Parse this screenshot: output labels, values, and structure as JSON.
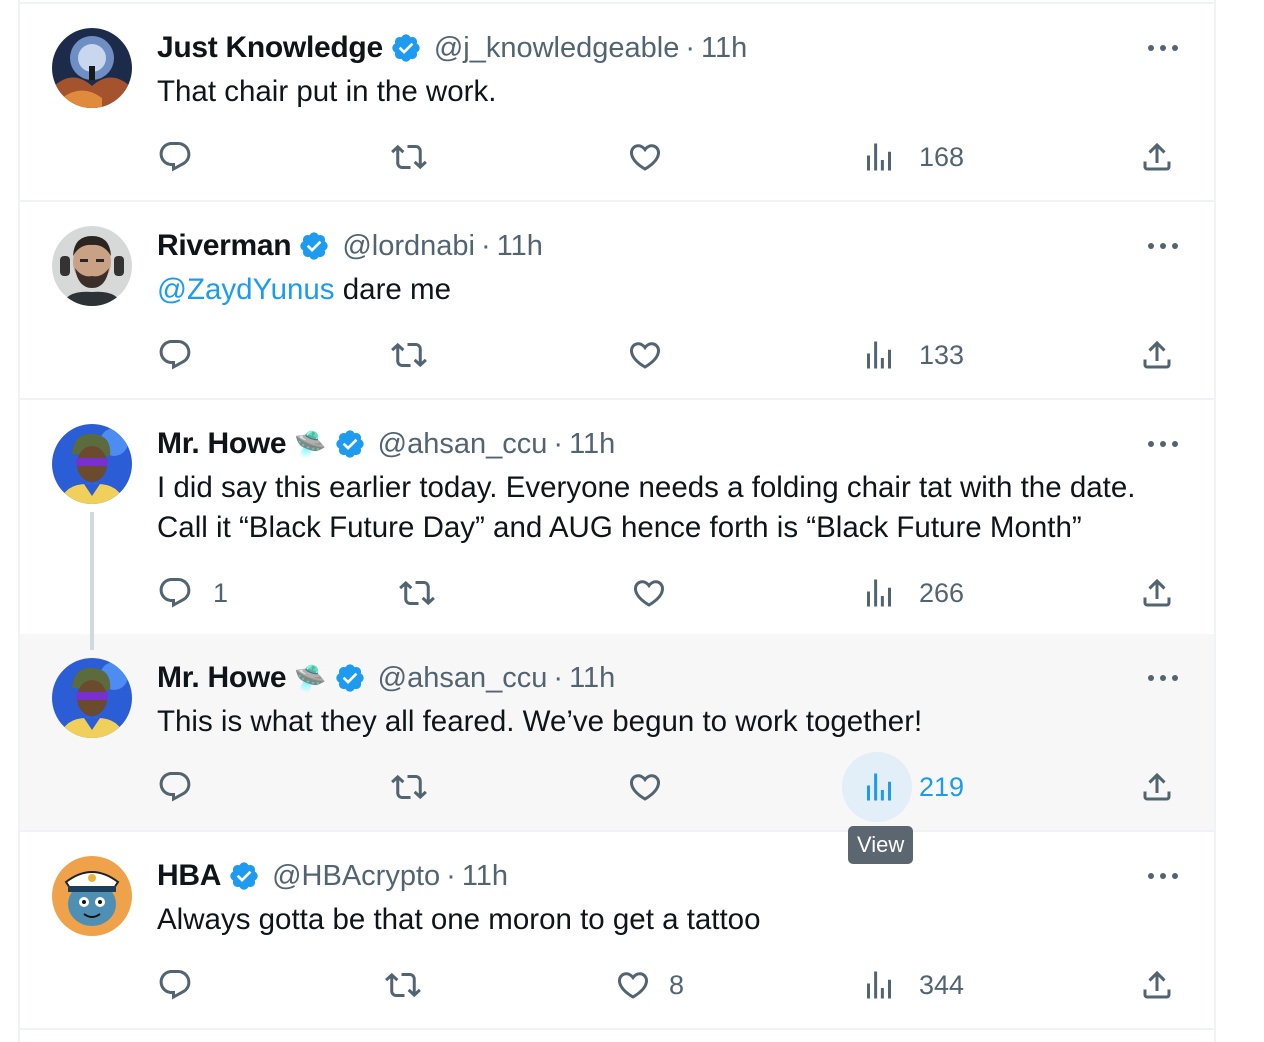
{
  "tweets": [
    {
      "name": "Just Knowledge",
      "emoji": "",
      "handle": "@j_knowledgeable",
      "time": "11h",
      "mention": "",
      "text": "That chair put in the work.",
      "text_line2": "",
      "reply_count": "",
      "like_count": "",
      "views": "168"
    },
    {
      "name": "Riverman",
      "emoji": "",
      "handle": "@lordnabi",
      "time": "11h",
      "mention": "@ZaydYunus",
      "text": " dare me",
      "text_line2": "",
      "reply_count": "",
      "like_count": "",
      "views": "133"
    },
    {
      "name": "Mr. Howe",
      "emoji": "🛸",
      "handle": "@ahsan_ccu",
      "time": "11h",
      "mention": "",
      "text": "I did say this earlier today. Everyone needs a folding chair tat with the date.",
      "text_line2": "Call it “Black Future Day” and AUG hence forth is “Black Future Month”",
      "reply_count": "1",
      "like_count": "",
      "views": "266"
    },
    {
      "name": "Mr. Howe",
      "emoji": "🛸",
      "handle": "@ahsan_ccu",
      "time": "11h",
      "mention": "",
      "text": "This is what they all feared. We’ve begun to work together!",
      "text_line2": "",
      "reply_count": "",
      "like_count": "",
      "views": "219"
    },
    {
      "name": "HBA",
      "emoji": "",
      "handle": "@HBAcrypto",
      "time": "11h",
      "mention": "",
      "text": "Always gotta be that one moron to get a tattoo",
      "text_line2": "",
      "reply_count": "",
      "like_count": "8",
      "views": "344"
    }
  ],
  "separator": "·",
  "tooltip": "View",
  "icons": {
    "reply": "reply-icon",
    "retweet": "retweet-icon",
    "like": "heart-icon",
    "views": "views-icon",
    "share": "share-icon",
    "more": "more-icon",
    "verified": "verified-badge-icon"
  },
  "colors": {
    "verified": "#1d9bf0",
    "icon": "#536471",
    "accent": "#1d9bf0",
    "hover_background": "#f7f7f7"
  }
}
